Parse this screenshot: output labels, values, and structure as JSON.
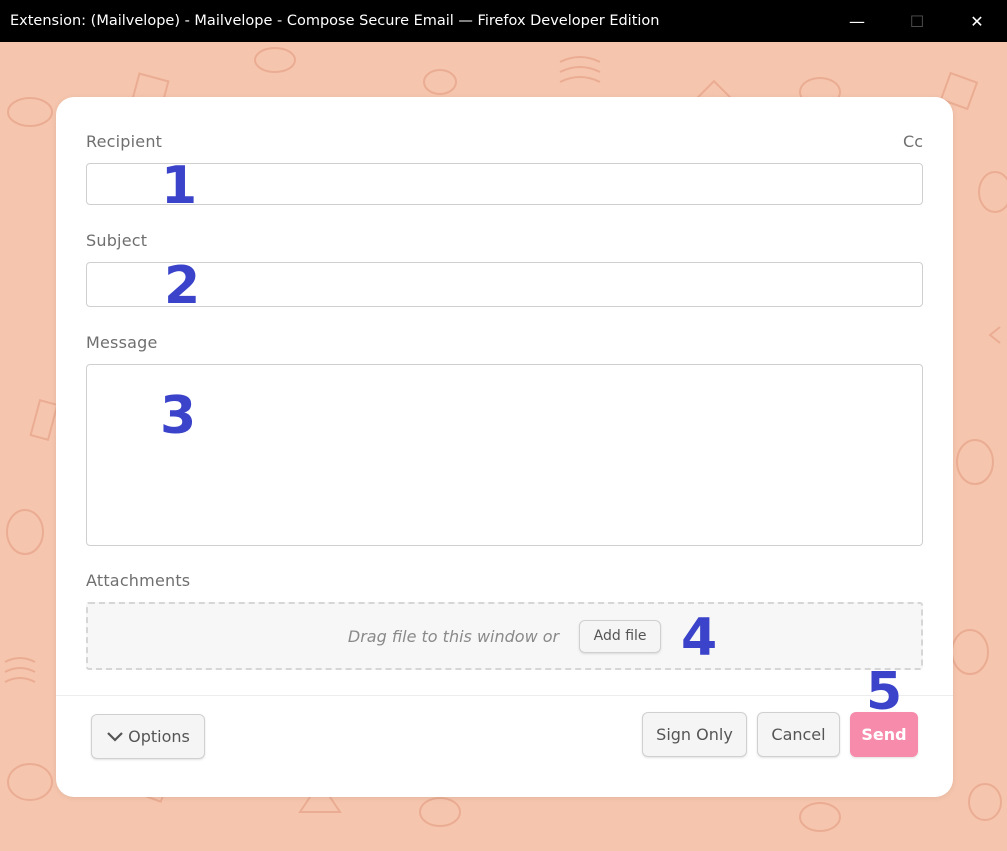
{
  "window": {
    "title": "Extension: (Mailvelope) - Mailvelope - Compose Secure Email — Firefox Developer Edition",
    "minimize_glyph": "—",
    "maximize_glyph": "☐",
    "close_glyph": "✕"
  },
  "form": {
    "recipient_label": "Recipient",
    "cc_label": "Cc",
    "recipient_value": "",
    "subject_label": "Subject",
    "subject_value": "",
    "message_label": "Message",
    "message_value": "",
    "attachments_label": "Attachments",
    "drag_text": "Drag file to this window or",
    "add_file_label": "Add file"
  },
  "footer": {
    "options_label": "Options",
    "sign_only_label": "Sign Only",
    "cancel_label": "Cancel",
    "send_label": "Send"
  },
  "markers": [
    "1",
    "2",
    "3",
    "4",
    "5"
  ],
  "colors": {
    "background": "#f6c5ad",
    "pattern_stroke": "#e8a78d",
    "send_button": "#f78bac",
    "marker": "#3a43c9",
    "titlebar": "#000000"
  },
  "icons": {
    "options": "chevron-down-icon",
    "background": "doodle-pattern"
  }
}
